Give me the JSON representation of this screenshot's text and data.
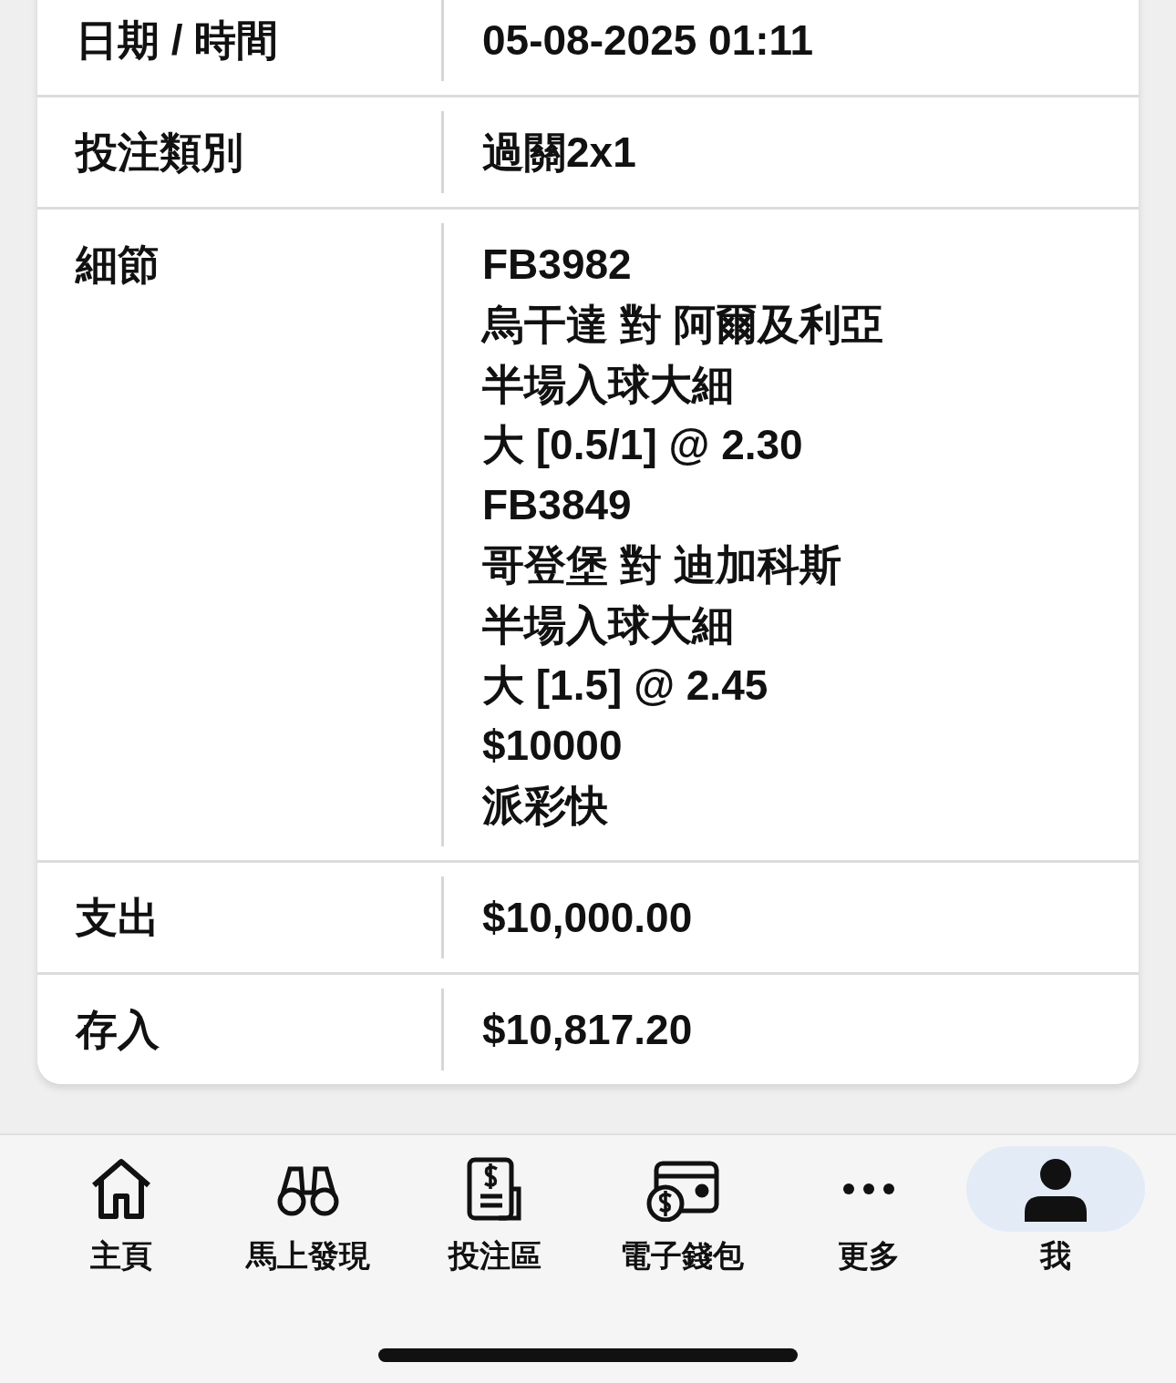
{
  "details_table": {
    "rows": [
      {
        "label": "日期 / 時間",
        "lines": [
          "05-08-2025 01:11"
        ]
      },
      {
        "label": "投注類別",
        "lines": [
          "過關2x1"
        ]
      },
      {
        "label": "細節",
        "lines": [
          "FB3982",
          "烏干達 對 阿爾及利亞",
          "半場入球大細",
          "大 [0.5/1] @ 2.30",
          "FB3849",
          "哥登堡 對 迪加科斯",
          "半場入球大細",
          "大 [1.5] @ 2.45",
          "$10000",
          "派彩快"
        ]
      },
      {
        "label": "支出",
        "lines": [
          "$10,000.00"
        ]
      },
      {
        "label": "存入",
        "lines": [
          "$10,817.20"
        ]
      }
    ]
  },
  "bottom_nav": [
    {
      "label": "主頁",
      "selected": false
    },
    {
      "label": "馬上發現",
      "selected": false
    },
    {
      "label": "投注區",
      "selected": false
    },
    {
      "label": "電子錢包",
      "selected": false
    },
    {
      "label": "更多",
      "selected": false
    },
    {
      "label": "我",
      "selected": true
    }
  ]
}
